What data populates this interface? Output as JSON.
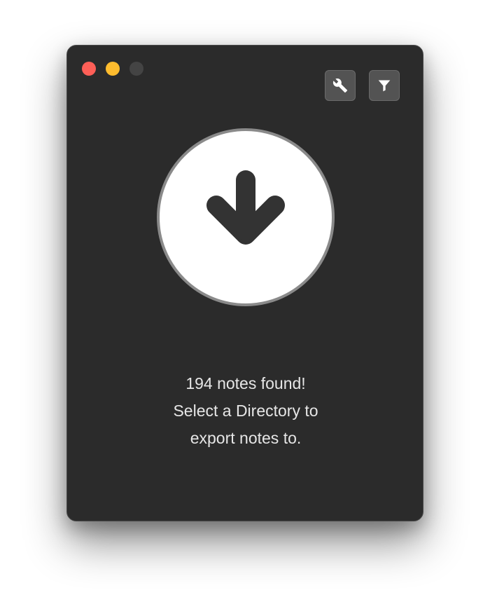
{
  "window": {
    "controls": [
      "close",
      "minimize",
      "zoom"
    ]
  },
  "toolbar": {
    "buttons": [
      {
        "icon": "wrench-icon",
        "role": "settings"
      },
      {
        "icon": "filter-icon",
        "role": "filter"
      }
    ]
  },
  "main": {
    "drop_target_icon": "arrow-down-icon",
    "message_lines": [
      "194 notes found!",
      "Select a Directory to",
      "export notes to."
    ]
  },
  "colors": {
    "window_bg": "#2b2b2b",
    "close": "#fe5f57",
    "minimize": "#febc2e",
    "zoom_disabled": "#444444",
    "tool_button_bg": "#535353",
    "circle_bg": "#ffffff",
    "circle_border": "#8a8a8a",
    "arrow": "#333333",
    "text": "#e6e6e6"
  }
}
